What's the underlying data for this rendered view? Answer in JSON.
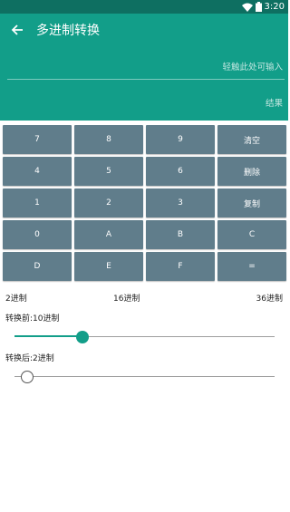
{
  "colors": {
    "primary": "#129e89",
    "status_bar": "#0e6f61",
    "key": "#607d8b"
  },
  "status_bar": {
    "time": "3:20",
    "wifi_icon": "wifi-icon",
    "battery_icon": "battery-icon"
  },
  "toolbar": {
    "back_icon": "arrow-back-icon",
    "title": "多进制转换"
  },
  "input": {
    "placeholder": "轻触此处可输入",
    "value": ""
  },
  "result": {
    "label": "结果"
  },
  "keypad": {
    "keys": [
      "7",
      "8",
      "9",
      "清空",
      "4",
      "5",
      "6",
      "删除",
      "1",
      "2",
      "3",
      "复制",
      "0",
      "A",
      "B",
      "C",
      "D",
      "E",
      "F",
      "="
    ]
  },
  "base_range": {
    "min_label": "2进制",
    "mid_label": "16进制",
    "max_label": "36进制"
  },
  "from_base": {
    "label": "转换前:10进制",
    "value": 10,
    "min": 2,
    "max": 36
  },
  "to_base": {
    "label": "转换后:2进制",
    "value": 2,
    "min": 2,
    "max": 36
  }
}
